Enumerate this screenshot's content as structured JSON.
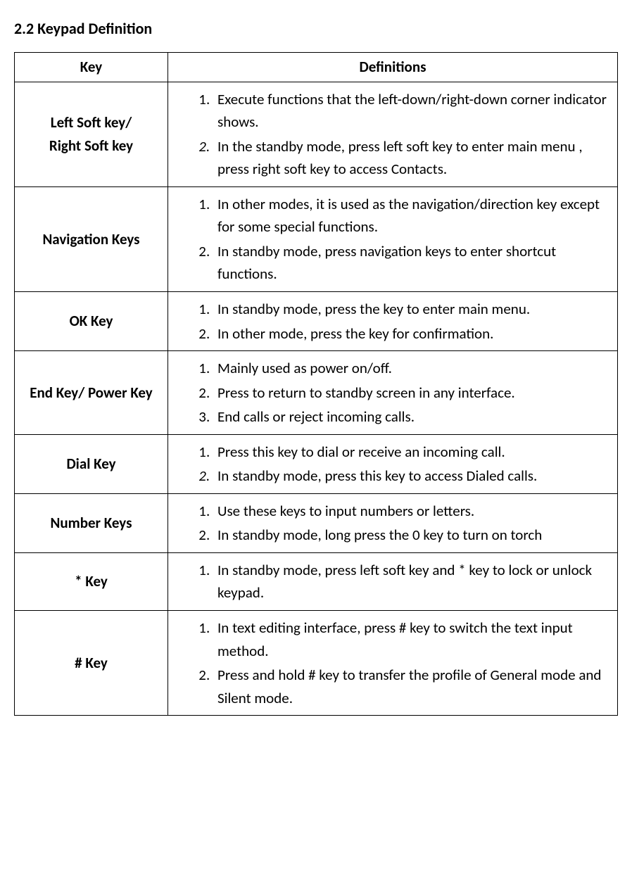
{
  "section_title": "2.2   Keypad Definition",
  "headers": {
    "key": "Key",
    "definitions": "Definitions"
  },
  "rows": [
    {
      "key_lines": [
        "Left Soft key/",
        "Right Soft key"
      ],
      "key_joined": "Left Soft key/ Right Soft key",
      "defs": [
        "Execute functions that the left-down/right-down corner indicator shows.",
        "In the standby mode, press left soft key to enter main menu , press right soft key to access Contacts."
      ],
      "ital_markers": [
        false,
        true
      ],
      "row_class": ""
    },
    {
      "key_lines": [
        "Navigation Keys"
      ],
      "key_joined": "Navigation Keys",
      "defs": [
        "In other modes, it is used as the navigation/direction key except for some special functions.",
        "In standby mode, press navigation keys to enter shortcut functions."
      ],
      "ital_markers": [
        false,
        false
      ],
      "row_class": ""
    },
    {
      "key_lines": [
        "OK Key"
      ],
      "key_joined": "OK Key",
      "defs": [
        "In standby mode, press the key to enter main menu.",
        "In other mode, press the key for confirmation."
      ],
      "ital_markers": [
        false,
        false
      ],
      "row_class": "tall"
    },
    {
      "key_lines": [
        "End Key/ Power Key"
      ],
      "key_joined": "End Key/ Power Key",
      "defs": [
        "Mainly used as power on/off.",
        "Press to return to standby screen in any interface.",
        "End calls or reject incoming calls."
      ],
      "ital_markers": [
        false,
        false,
        false
      ],
      "row_class": "med"
    },
    {
      "key_lines": [
        "Dial Key"
      ],
      "key_joined": "Dial Key",
      "defs": [
        "Press this key to dial or receive an incoming call.",
        "In standby mode, press this key to access Dialed calls."
      ],
      "ital_markers": [
        false,
        true
      ],
      "row_class": "tall"
    },
    {
      "key_lines": [
        "Number Keys"
      ],
      "key_joined": "Number Keys",
      "defs": [
        "Use these keys to input numbers or letters.",
        "In standby mode, long press the 0 key to turn on torch"
      ],
      "ital_markers": [
        false,
        false
      ],
      "row_class": "tall"
    },
    {
      "key_lines": [
        "* Key"
      ],
      "key_joined": "* Key",
      "defs": [
        "In standby mode, press left soft key and * key to lock or unlock keypad."
      ],
      "ital_markers": [
        false
      ],
      "row_class": "tall"
    },
    {
      "key_lines": [
        "# Key"
      ],
      "key_joined": "# Key",
      "defs": [
        "In text editing interface, press # key to switch the text input method.",
        "Press and hold # key to transfer the profile of General mode and Silent mode."
      ],
      "ital_markers": [
        false,
        false
      ],
      "row_class": ""
    }
  ]
}
